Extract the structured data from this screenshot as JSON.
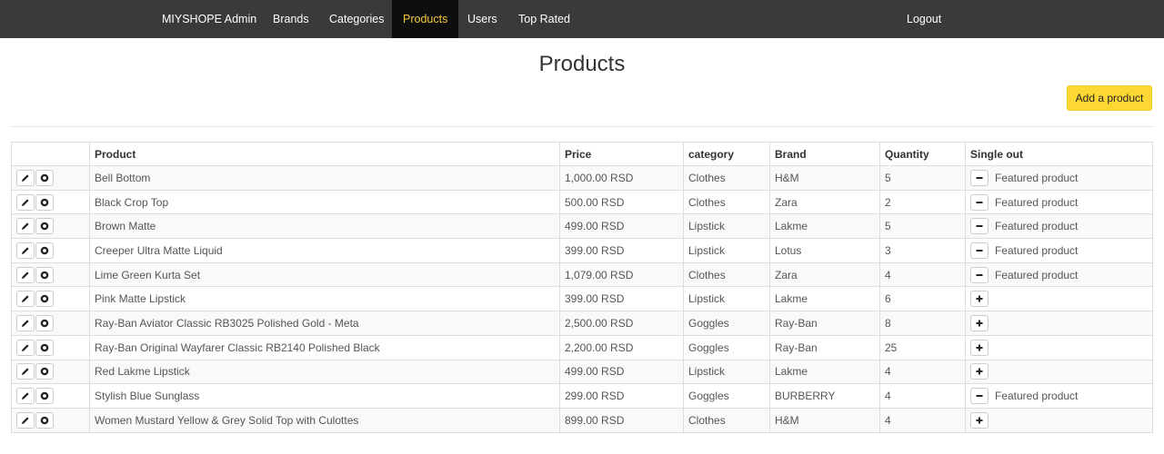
{
  "nav": {
    "brand": "MIYSHOPE Admin",
    "items": [
      {
        "label": "Brands",
        "active": false
      },
      {
        "label": "Categories",
        "active": false
      },
      {
        "label": "Products",
        "active": true
      },
      {
        "label": "Users",
        "active": false
      },
      {
        "label": "Top Rated",
        "active": false
      }
    ],
    "logout": "Logout"
  },
  "page": {
    "title": "Products",
    "add_button": "Add a product"
  },
  "table": {
    "headers": {
      "actions": "",
      "product": "Product",
      "price": "Price",
      "category": "category",
      "brand": "Brand",
      "quantity": "Quantity",
      "single_out": "Single out"
    },
    "rows": [
      {
        "product": "Bell Bottom",
        "price": "1,000.00 RSD",
        "category": "Clothes",
        "brand": "H&M",
        "quantity": "5",
        "featured": true
      },
      {
        "product": "Black Crop Top",
        "price": "500.00 RSD",
        "category": "Clothes",
        "brand": "Zara",
        "quantity": "2",
        "featured": true
      },
      {
        "product": "Brown Matte",
        "price": "499.00 RSD",
        "category": "Lipstick",
        "brand": "Lakme",
        "quantity": "5",
        "featured": true
      },
      {
        "product": "Creeper Ultra Matte Liquid",
        "price": "399.00 RSD",
        "category": "Lipstick",
        "brand": "Lotus",
        "quantity": "3",
        "featured": true
      },
      {
        "product": "Lime Green Kurta Set",
        "price": "1,079.00 RSD",
        "category": "Clothes",
        "brand": "Zara",
        "quantity": "4",
        "featured": true
      },
      {
        "product": "Pink Matte Lipstick",
        "price": "399.00 RSD",
        "category": "Lipstick",
        "brand": "Lakme",
        "quantity": "6",
        "featured": false
      },
      {
        "product": "Ray-Ban Aviator Classic RB3025 Polished Gold - Meta",
        "price": "2,500.00 RSD",
        "category": "Goggles",
        "brand": "Ray-Ban",
        "quantity": "8",
        "featured": false
      },
      {
        "product": "Ray-Ban Original Wayfarer Classic RB2140 Polished Black",
        "price": "2,200.00 RSD",
        "category": "Goggles",
        "brand": "Ray-Ban",
        "quantity": "25",
        "featured": false
      },
      {
        "product": "Red Lakme Lipstick",
        "price": "499.00 RSD",
        "category": "Lipstick",
        "brand": "Lakme",
        "quantity": "4",
        "featured": false
      },
      {
        "product": "Stylish Blue Sunglass",
        "price": "299.00 RSD",
        "category": "Goggles",
        "brand": "BURBERRY",
        "quantity": "4",
        "featured": true
      },
      {
        "product": "Women Mustard Yellow & Grey Solid Top with Culottes",
        "price": "899.00 RSD",
        "category": "Clothes",
        "brand": "H&M",
        "quantity": "4",
        "featured": false
      }
    ],
    "featured_label": "Featured product",
    "row_icons": {
      "edit": "pencil-icon",
      "delete": "delete-icon",
      "unfeature": "minus-icon",
      "feature": "plus-icon"
    }
  },
  "colors": {
    "navbar_bg": "#3a3a3a",
    "nav_active_bg": "#0e0e0e",
    "nav_active_text": "#f3c63d",
    "add_button_bg": "#fdd835"
  }
}
